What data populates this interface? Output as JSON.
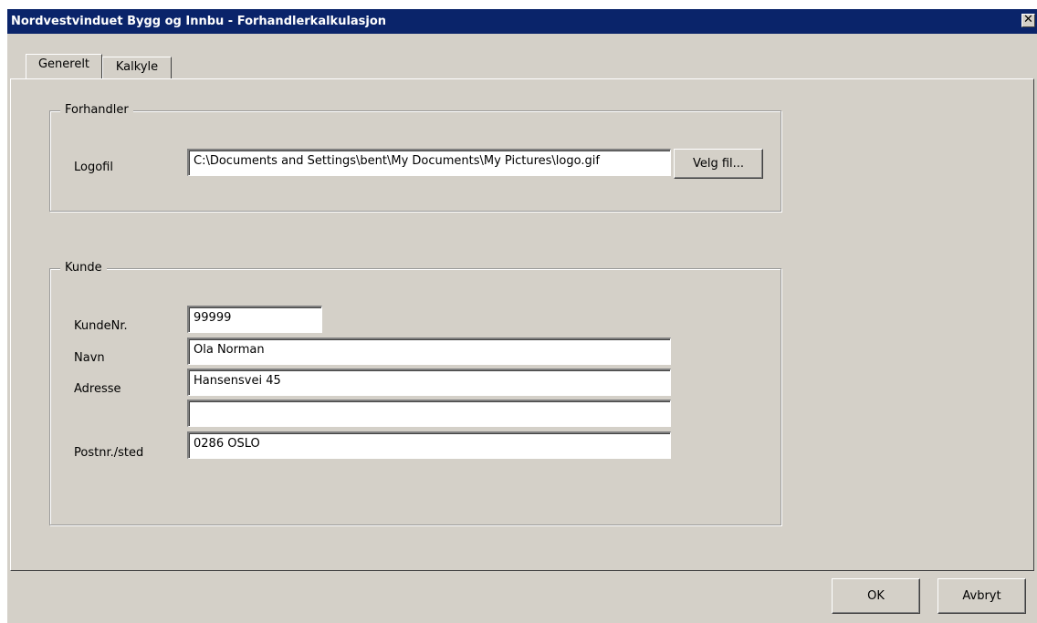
{
  "window": {
    "title": "Nordvestvinduet Bygg og Innbu - Forhandlerkalkulasjon",
    "close_glyph": "✕"
  },
  "tabs": [
    {
      "label": "Generelt",
      "active": true
    },
    {
      "label": "Kalkyle",
      "active": false
    }
  ],
  "forhandler": {
    "legend": "Forhandler",
    "logofil_label": "Logofil",
    "logofil_value": "C:\\Documents and Settings\\bent\\My Documents\\My Pictures\\logo.gif",
    "velg_fil_label": "Velg fil..."
  },
  "kunde": {
    "legend": "Kunde",
    "kundenr_label": "KundeNr.",
    "kundenr_value": "99999",
    "navn_label": "Navn",
    "navn_value": "Ola Norman",
    "adresse_label": "Adresse",
    "adresse_value": "Hansensvei 45",
    "adresse2_value": "",
    "postnr_label": "Postnr./sted",
    "postnr_value": "0286 OSLO"
  },
  "buttons": {
    "ok_label": "OK",
    "avbryt_label": "Avbryt"
  },
  "colors": {
    "titlebar": "#0a246a",
    "dialog_face": "#d4d0c8"
  }
}
